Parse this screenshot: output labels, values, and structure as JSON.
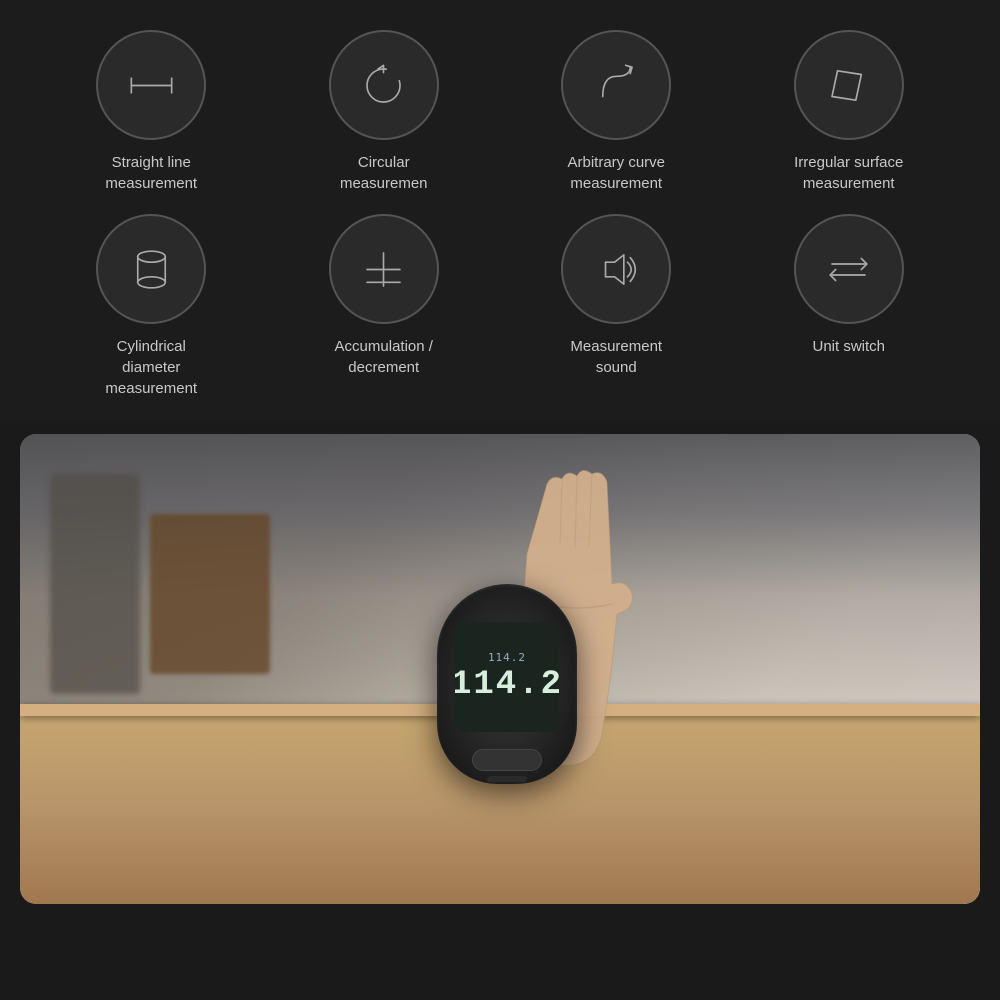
{
  "features_row1": [
    {
      "id": "straight-line",
      "label": "Straight line\nmeasurement",
      "icon": "straight-line-icon"
    },
    {
      "id": "circular",
      "label": "Circular\nmeasuremen",
      "icon": "circular-icon"
    },
    {
      "id": "arbitrary-curve",
      "label": "Arbitrary curve\nmeasurement",
      "icon": "arbitrary-curve-icon"
    },
    {
      "id": "irregular-surface",
      "label": "Irregular surface\nmeasurement",
      "icon": "irregular-surface-icon"
    }
  ],
  "features_row2": [
    {
      "id": "cylindrical",
      "label": "Cylindrical\ndiameter\nmeasurement",
      "icon": "cylindrical-icon"
    },
    {
      "id": "accumulation",
      "label": "Accumulation /\ndecrement",
      "icon": "accumulation-icon"
    },
    {
      "id": "measurement-sound",
      "label": "Measurement\nsound",
      "icon": "sound-icon"
    },
    {
      "id": "unit-switch",
      "label": "Unit switch",
      "icon": "unit-switch-icon"
    }
  ],
  "device": {
    "screen_small": "114.2",
    "screen_main": "114.2"
  }
}
